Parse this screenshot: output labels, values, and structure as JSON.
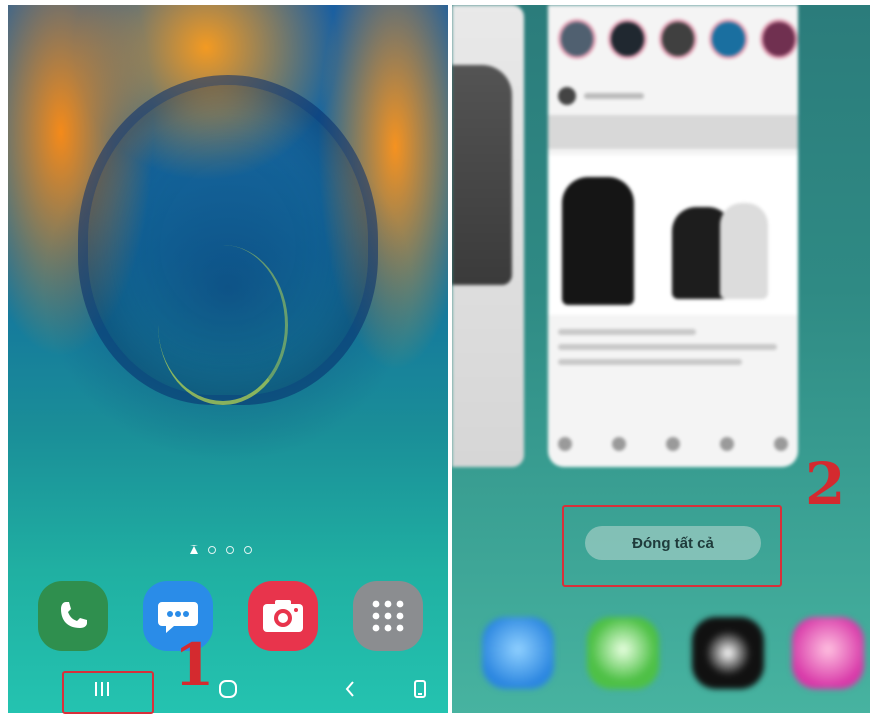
{
  "left_screen": {
    "page_indicator": {
      "count": 4,
      "active": 0
    },
    "dock": [
      {
        "name": "phone-app-icon"
      },
      {
        "name": "messages-app-icon"
      },
      {
        "name": "camera-app-icon"
      },
      {
        "name": "apps-drawer-icon"
      }
    ],
    "navbar": {
      "recents_icon": "recents-icon",
      "home_icon": "home-icon",
      "back_icon": "back-icon",
      "extra_icon": "screen-icon"
    },
    "step_label": "1"
  },
  "right_screen": {
    "close_all_label": "Đóng tất cả",
    "step_label": "2"
  },
  "colors": {
    "highlight": "#d8303a",
    "step_number": "#d42a2f",
    "phone_app": "#2f8f4e",
    "messages_app": "#2a8ce8",
    "camera_app": "#e8344c",
    "apps_drawer": "#8b8d90"
  }
}
